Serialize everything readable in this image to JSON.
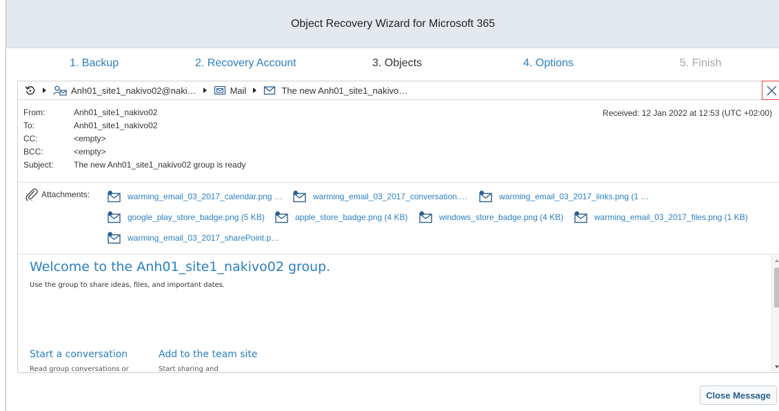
{
  "window": {
    "title": "Object Recovery Wizard for Microsoft 365"
  },
  "steps": [
    {
      "label": "1. Backup",
      "state": "done"
    },
    {
      "label": "2. Recovery Account",
      "state": "done"
    },
    {
      "label": "3. Objects",
      "state": "current"
    },
    {
      "label": "4. Options",
      "state": "done"
    },
    {
      "label": "5. Finish",
      "state": "disabled"
    }
  ],
  "breadcrumb": {
    "icons": [
      "refresh-icon",
      "user-mailbox-icon",
      "mail-folder-icon",
      "envelope-icon"
    ],
    "account": "Anh01_site1_nakivo02@naki…",
    "folder": "Mail",
    "message": "The new Anh01_site1_nakivo…"
  },
  "headers": {
    "from_label": "From:",
    "from": "Anh01_site1_nakivo02",
    "to_label": "To:",
    "to": "Anh01_site1_nakivo02",
    "cc_label": "CC:",
    "cc": "<empty>",
    "bcc_label": "BCC:",
    "bcc": "<empty>",
    "subject_label": "Subject:",
    "subject": "The new Anh01_site1_nakivo02 group is ready",
    "received": "Received: 12 Jan 2022 at 12:53 (UTC +02:00)"
  },
  "attachments": {
    "label": "Attachments:",
    "items": [
      "warming_email_03_2017_calendar.png …",
      "warming_email_03_2017_conversation.…",
      "warming_email_03_2017_links.png (1 …",
      "google_play_store_badge.png (5 KB)",
      "apple_store_badge.png (4 KB)",
      "windows_store_badge.png (4 KB)",
      "warming_email_03_2017_files.png (1 KB)",
      "warming_email_03_2017_sharePoint.p…"
    ]
  },
  "body": {
    "heading": "Welcome to the Anh01_site1_nakivo02 group.",
    "intro": "Use the group to share ideas, files, and important dates.",
    "col1_title": "Start a conversation",
    "col1_text": "Read group conversations or",
    "col2_title": "Add to the team site",
    "col2_text": "Start sharing and"
  },
  "buttons": {
    "close_message": "Close Message"
  },
  "colors": {
    "link": "#2a7fc1",
    "titlebar": "#e4e9ef",
    "close_border": "#e03a3a"
  }
}
